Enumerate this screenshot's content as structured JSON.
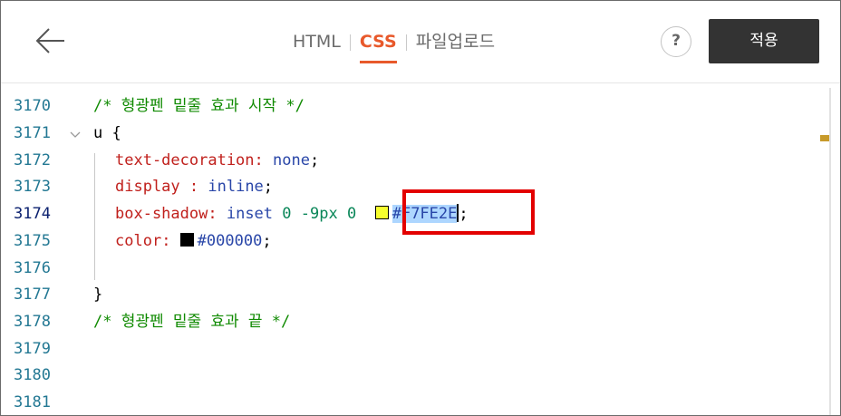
{
  "header": {
    "tabs": [
      {
        "label": "HTML",
        "active": false
      },
      {
        "label": "CSS",
        "active": true
      },
      {
        "label": "파일업로드",
        "active": false
      }
    ],
    "help_label": "?",
    "apply_label": "적용"
  },
  "editor": {
    "line_numbers": [
      "3170",
      "3171",
      "3172",
      "3173",
      "3174",
      "3175",
      "3176",
      "3177",
      "3178",
      "3179",
      "3180",
      "3181"
    ],
    "current_line": "3174",
    "lines": {
      "l3170_comment": "/* 형광펜 밑줄 효과 시작 */",
      "l3171_selector": "u",
      "l3171_brace": " {",
      "l3172_prop": "text-decoration",
      "l3172_colon": ": ",
      "l3172_val": "none",
      "l3172_end": ";",
      "l3173_prop": "display",
      "l3173_colon": " : ",
      "l3173_val": "inline",
      "l3173_end": ";",
      "l3174_prop": "box-shadow",
      "l3174_colon": ": ",
      "l3174_val1": "inset",
      "l3174_num1": "0",
      "l3174_num2": "-9px",
      "l3174_num3": "0",
      "l3174_color": "#F7FE2E",
      "l3174_end": ";",
      "l3175_prop": "color",
      "l3175_colon": ": ",
      "l3175_color": "#000000",
      "l3175_end": ";",
      "l3177_brace": "}",
      "l3178_comment": "/* 형광펜 밑줄 효과 끝 */"
    },
    "swatch_colors": {
      "highlight": "#F7FE2E",
      "text": "#000000"
    }
  },
  "colors": {
    "accent": "#e8592b",
    "apply_button": "#333333",
    "annotation_box": "#e30000"
  }
}
